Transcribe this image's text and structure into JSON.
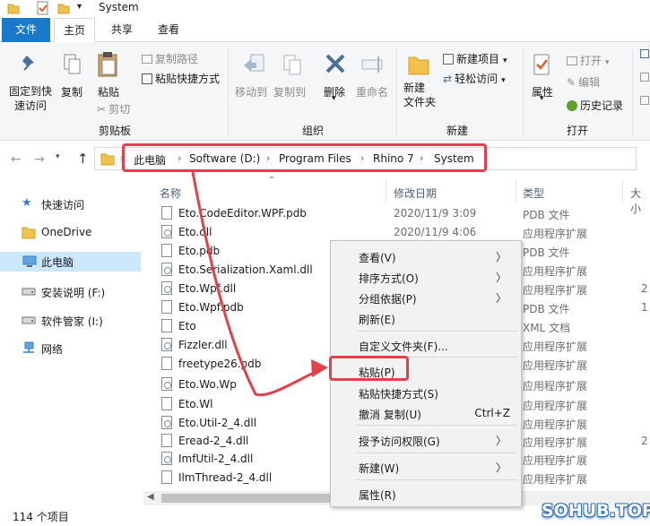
{
  "window": {
    "title": "System"
  },
  "tabs": [
    {
      "label": "文件"
    },
    {
      "label": "主页"
    },
    {
      "label": "共享"
    },
    {
      "label": "查看"
    }
  ],
  "ribbon": {
    "pin_label": [
      "固定到快",
      "速访问"
    ],
    "copy_label": "复制",
    "paste_label": "粘贴",
    "copy_path_label": "复制路径",
    "paste_shortcut_label": "粘贴快捷方式",
    "cut_label": "剪切",
    "clipboard_group": "剪贴板",
    "move_to_label": "移动到",
    "copy_to_label": "复制到",
    "delete_label": "删除",
    "rename_label": "重命名",
    "organize_group": "组织",
    "new_folder_label": [
      "新建",
      "文件夹"
    ],
    "new_item_label": "新建项目",
    "easy_access_label": "轻松访问",
    "new_group": "新建",
    "properties_label": "属性",
    "open_label": "打开",
    "edit_label": "编辑",
    "history_label": "历史记录",
    "open_group": "打开"
  },
  "address": {
    "crumbs": [
      "此电脑",
      "Software (D:)",
      "Program Files",
      "Rhino 7",
      "System"
    ]
  },
  "nav": {
    "items": [
      {
        "label": "快速访问",
        "icon": "star-icon"
      },
      {
        "label": "OneDrive",
        "icon": "folder-icon"
      },
      {
        "label": "此电脑",
        "icon": "computer-icon"
      },
      {
        "label": "安装说明 (F:)",
        "icon": "drive-icon"
      },
      {
        "label": "软件管家 (I:)",
        "icon": "drive-icon"
      },
      {
        "label": "网络",
        "icon": "network-icon"
      }
    ]
  },
  "columns": {
    "name": "名称",
    "date": "修改日期",
    "type": "类型",
    "size": "大小"
  },
  "files": [
    {
      "name": "Eto.CodeEditor.WPF.pdb",
      "date": "2020/11/9 3:09",
      "type": "PDB 文件",
      "size": "",
      "kind": "pdb"
    },
    {
      "name": "Eto.dll",
      "date": "2020/11/9 4:06",
      "type": "应用程序扩展",
      "size": "",
      "kind": "dll"
    },
    {
      "name": "Eto.pdb",
      "date": "",
      "type": "PDB 文件",
      "size": "",
      "kind": "pdb"
    },
    {
      "name": "Eto.Serialization.Xaml.dll",
      "date": "",
      "type": "应用程序扩展",
      "size": "",
      "kind": "dll"
    },
    {
      "name": "Eto.Wpf.dll",
      "date": "",
      "type": "应用程序扩展",
      "size": "2",
      "kind": "dll"
    },
    {
      "name": "Eto.Wpf.pdb",
      "date": "",
      "type": "PDB 文件",
      "size": "1",
      "kind": "pdb"
    },
    {
      "name": "Eto",
      "date": "",
      "type": "XML 文档",
      "size": "",
      "kind": "pdb"
    },
    {
      "name": "Fizzler.dll",
      "date": "",
      "type": "应用程序扩展",
      "size": "",
      "kind": "dll"
    },
    {
      "name": "freetype26.pdb",
      "date": "",
      "type": "应用程序扩展",
      "size": "",
      "kind": "pdb"
    },
    {
      "name": "Eto.Wo.Wp",
      "date": "",
      "type": "应用程序扩展",
      "size": "",
      "kind": "dll"
    },
    {
      "name": "Eto.Wl",
      "date": "",
      "type": "应用程序扩展",
      "size": "",
      "kind": "pdb"
    },
    {
      "name": "Eto.Util-2_4.dll",
      "date": "",
      "type": "应用程序扩展",
      "size": "",
      "kind": "dll"
    },
    {
      "name": "Eread-2_4.dll",
      "date": "",
      "type": "应用程序扩展",
      "size": "2",
      "kind": "pdb"
    },
    {
      "name": "ImfUtil-2_4.dll",
      "date": "",
      "type": "应用程序扩展",
      "size": "",
      "kind": "dll"
    },
    {
      "name": "IlmThread-2_4.dll",
      "date": "",
      "type": "应用程序扩展",
      "size": "",
      "kind": "pdb"
    }
  ],
  "status": {
    "count": "114 个项目"
  },
  "context_menu": {
    "view": "查看(V)",
    "sort": "排序方式(O)",
    "group": "分组依据(P)",
    "refresh": "刷新(E)",
    "customize": "自定义文件夹(F)...",
    "paste": "粘贴(P)",
    "paste_shortcut": "粘贴快捷方式(S)",
    "undo_copy": "撤消 复制(U)",
    "undo_shortcut": "Ctrl+Z",
    "grant_access": "授予访问权限(G)",
    "new": "新建(W)",
    "properties": "属性(R)"
  },
  "watermark": "SOHUB.TOP",
  "colors": {
    "accent": "#1979ca",
    "highlight": "#e2404a",
    "selection": "#cce8ff"
  }
}
